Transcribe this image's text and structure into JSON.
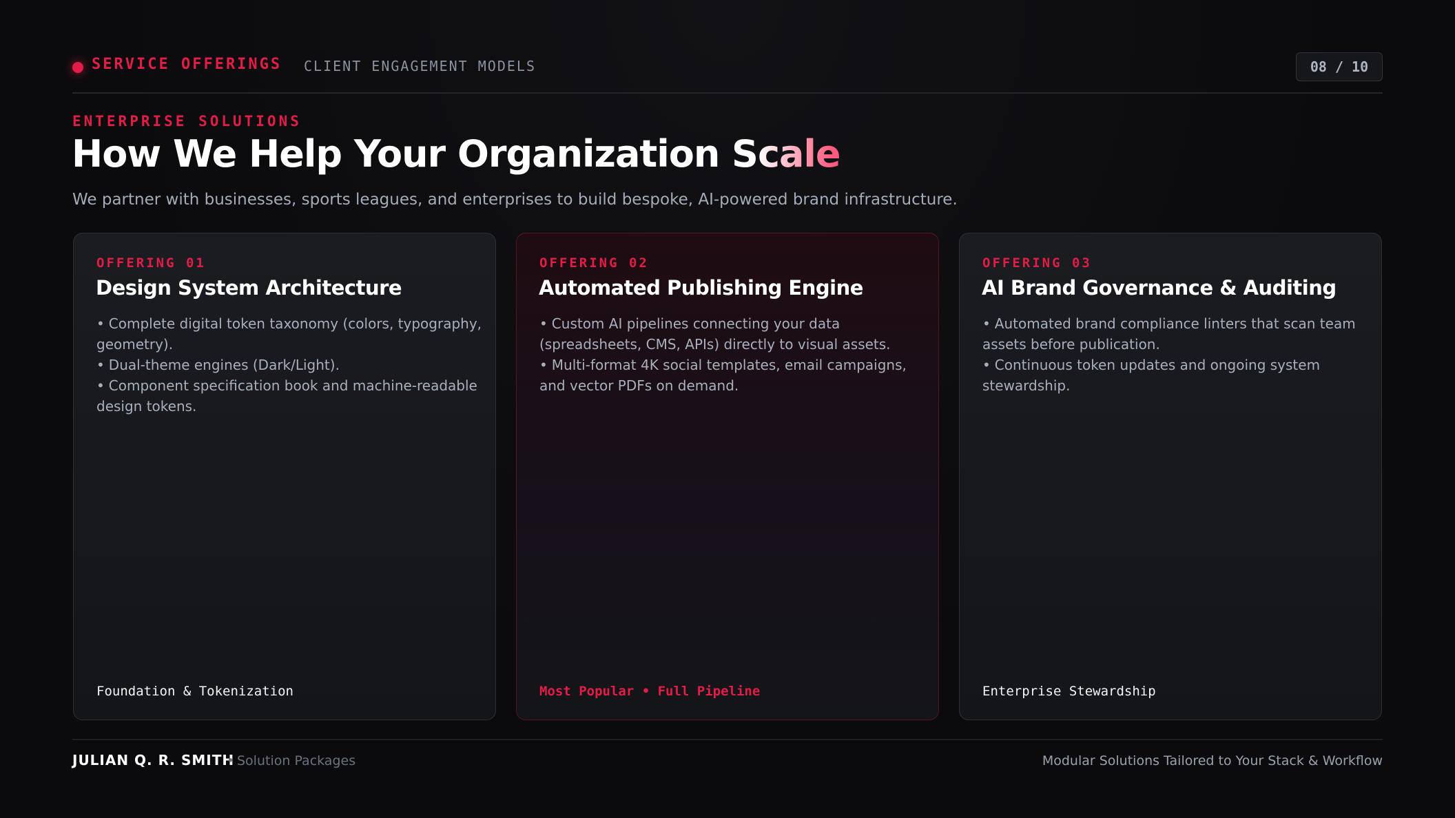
{
  "header": {
    "section_label": "SERVICE OFFERINGS",
    "section_sub": "CLIENT ENGAGEMENT MODELS",
    "page_counter": "08 / 10"
  },
  "hero": {
    "eyebrow": "ENTERPRISE SOLUTIONS",
    "headline_main": "How We Help Your Organization S",
    "headline_accent": "cale",
    "lede": "We partner with businesses, sports leagues, and enterprises to build bespoke, AI-powered brand infrastructure."
  },
  "offerings": [
    {
      "kicker": "OFFERING 01",
      "title": "Design System Architecture",
      "bullets": [
        "Complete digital token taxonomy (colors, typography, geometry).",
        "Dual-theme engines (Dark/Light).",
        "Component specification book and machine-readable design tokens."
      ],
      "tagline": "Foundation & Tokenization"
    },
    {
      "kicker": "OFFERING 02",
      "title": "Automated Publishing Engine",
      "bullets": [
        "Custom AI pipelines connecting your data (spreadsheets, CMS, APIs) directly to visual assets.",
        "Multi-format 4K social templates, email campaigns, and vector PDFs on demand."
      ],
      "tagline": "Most Popular • Full Pipeline"
    },
    {
      "kicker": "OFFERING 03",
      "title": "AI Brand Governance & Auditing",
      "bullets": [
        "Automated brand compliance linters that scan team assets before publication.",
        "Continuous token updates and ongoing system stewardship."
      ],
      "tagline": "Enterprise Stewardship"
    }
  ],
  "footer": {
    "name": "JULIAN Q. R. SMITH",
    "separator": "•",
    "sub": "Solution Packages",
    "right": "Modular Solutions Tailored to Your Stack & Workflow"
  },
  "bullet_glyph": "•",
  "colors": {
    "accent": "#e11d48",
    "background": "#0b0b0d",
    "card": "#1a1c21",
    "muted_text": "#a8b0bd"
  }
}
